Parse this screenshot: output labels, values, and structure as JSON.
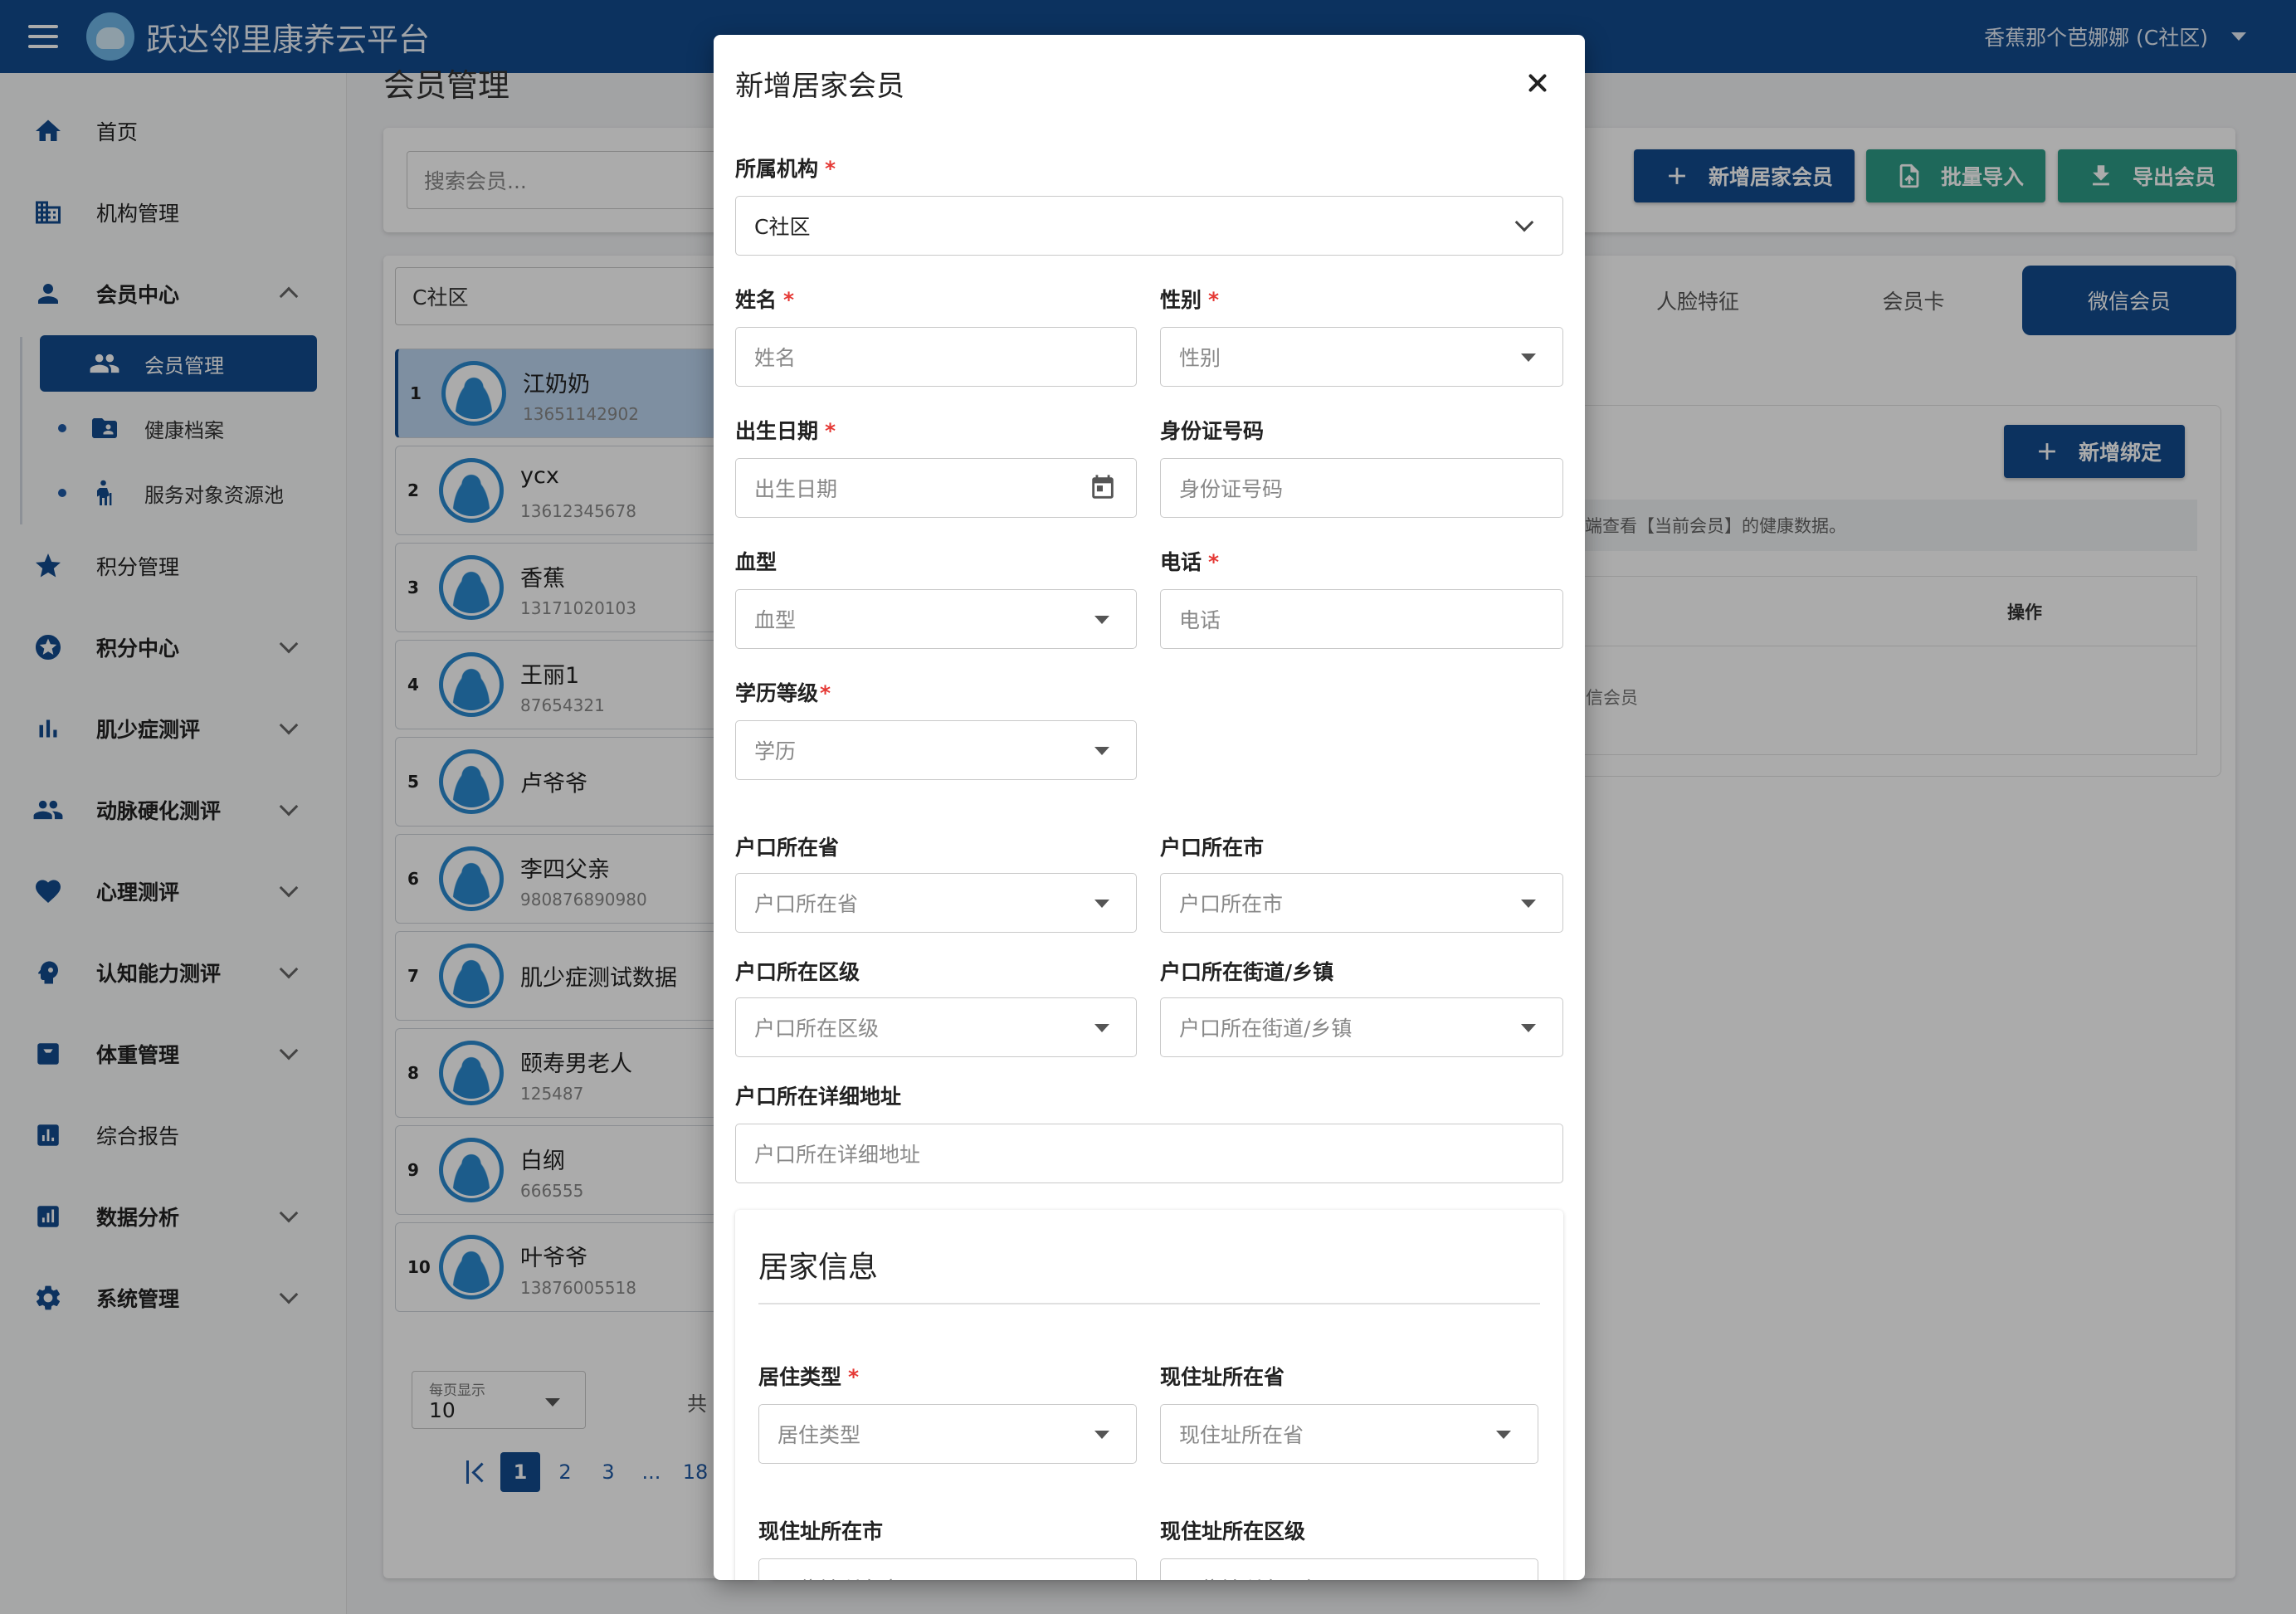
{
  "app": {
    "title": "跃达邻里康养云平台",
    "user": "香蕉那个芭娜娜 (C社区)"
  },
  "sidebar": {
    "items": [
      {
        "label": "首页"
      },
      {
        "label": "机构管理"
      },
      {
        "label": "会员中心"
      },
      {
        "label": "积分管理"
      },
      {
        "label": "积分中心"
      },
      {
        "label": "肌少症测评"
      },
      {
        "label": "动脉硬化测评"
      },
      {
        "label": "心理测评"
      },
      {
        "label": "认知能力测评"
      },
      {
        "label": "体重管理"
      },
      {
        "label": "综合报告"
      },
      {
        "label": "数据分析"
      },
      {
        "label": "系统管理"
      }
    ],
    "sub_items": [
      {
        "label": "会员管理"
      },
      {
        "label": "健康档案"
      },
      {
        "label": "服务对象资源池"
      }
    ]
  },
  "main": {
    "page_title": "会员管理",
    "search_placeholder": "搜索会员...",
    "buttons": {
      "add": "新增居家会员",
      "import": "批量导入",
      "export": "导出会员"
    },
    "org": "C社区",
    "members": [
      {
        "no": "1",
        "name": "江奶奶",
        "phone": "13651142902"
      },
      {
        "no": "2",
        "name": "ycx",
        "phone": "13612345678"
      },
      {
        "no": "3",
        "name": "香蕉",
        "phone": "13171020103"
      },
      {
        "no": "4",
        "name": "王丽1",
        "phone": "87654321"
      },
      {
        "no": "5",
        "name": "卢爷爷",
        "phone": ""
      },
      {
        "no": "6",
        "name": "李四父亲",
        "phone": "980876890980"
      },
      {
        "no": "7",
        "name": "肌少症测试数据",
        "phone": ""
      },
      {
        "no": "8",
        "name": "颐寿男老人",
        "phone": "125487"
      },
      {
        "no": "9",
        "name": "白纲",
        "phone": "666555"
      },
      {
        "no": "10",
        "name": "叶爷爷",
        "phone": "13876005518"
      }
    ],
    "pagination": {
      "per_page_label": "每页显示",
      "per_page": "10",
      "total_prefix": "共",
      "pages": [
        "1",
        "2",
        "3",
        "...",
        "18"
      ]
    },
    "tabs": [
      "人脸特征",
      "会员卡",
      "微信会员"
    ],
    "bind_button": "新增绑定",
    "hint": "端查看【当前会员】的健康数据。",
    "table_op": "操作",
    "table_empty": "信会员"
  },
  "modal": {
    "title": "新增居家会员",
    "fields": {
      "org": {
        "label": "所属机构",
        "value": "C社区"
      },
      "name": {
        "label": "姓名",
        "placeholder": "姓名"
      },
      "gender": {
        "label": "性别",
        "placeholder": "性别"
      },
      "birth": {
        "label": "出生日期",
        "placeholder": "出生日期"
      },
      "idcard": {
        "label": "身份证号码",
        "placeholder": "身份证号码"
      },
      "blood": {
        "label": "血型",
        "placeholder": "血型"
      },
      "phone": {
        "label": "电话",
        "placeholder": "电话"
      },
      "edu": {
        "label": "学历等级",
        "placeholder": "学历"
      },
      "hukou_prov": {
        "label": "户口所在省",
        "placeholder": "户口所在省"
      },
      "hukou_city": {
        "label": "户口所在市",
        "placeholder": "户口所在市"
      },
      "hukou_dist": {
        "label": "户口所在区级",
        "placeholder": "户口所在区级"
      },
      "hukou_street": {
        "label": "户口所在街道/乡镇",
        "placeholder": "户口所在街道/乡镇"
      },
      "hukou_addr": {
        "label": "户口所在详细地址",
        "placeholder": "户口所在详细地址"
      }
    },
    "home": {
      "title": "居家信息",
      "fields": {
        "type": {
          "label": "居住类型",
          "placeholder": "居住类型"
        },
        "prov": {
          "label": "现住址所在省",
          "placeholder": "现住址所在省"
        },
        "city": {
          "label": "现住址所在市",
          "placeholder": "现住址所在市"
        },
        "dist": {
          "label": "现住址所在区级",
          "placeholder": "现住址所在区级"
        }
      }
    }
  },
  "colors": {
    "primary": "#134b8e",
    "teal": "#2d9c86",
    "required": "#e53935"
  }
}
